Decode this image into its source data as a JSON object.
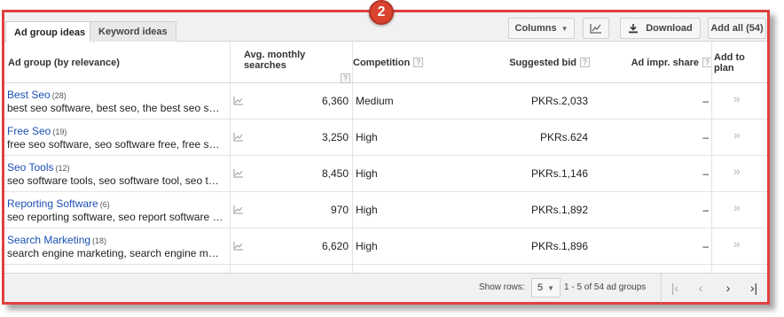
{
  "badge": "2",
  "tabs": [
    {
      "label": "Ad group ideas",
      "active": true
    },
    {
      "label": "Keyword ideas",
      "active": false
    }
  ],
  "toolbar": {
    "columns_label": "Columns",
    "chart_icon": "line-chart-icon",
    "download_label": "Download",
    "add_all_label": "Add all (54)"
  },
  "headers": {
    "ad_group": "Ad group (by relevance)",
    "avg_monthly": "Avg. monthly searches",
    "competition": "Competition",
    "suggested_bid": "Suggested bid",
    "ad_impr_share": "Ad impr. share",
    "add_to_plan": "Add to plan",
    "help_glyph": "?"
  },
  "rows": [
    {
      "name": "Best Seo",
      "count": "(28)",
      "keywords": "best seo software, best seo, the best seo software",
      "avg": "6,360",
      "competition": "Medium",
      "bid": "PKRs.2,033",
      "impr": "–",
      "add": "»"
    },
    {
      "name": "Free Seo",
      "count": "(19)",
      "keywords": "free seo software, seo software free, free seo tools",
      "avg": "3,250",
      "competition": "High",
      "bid": "PKRs.624",
      "impr": "–",
      "add": "»"
    },
    {
      "name": "Seo Tools",
      "count": "(12)",
      "keywords": "seo software tools, seo software tool, seo tools software",
      "avg": "8,450",
      "competition": "High",
      "bid": "PKRs.1,146",
      "impr": "–",
      "add": "»"
    },
    {
      "name": "Reporting Software",
      "count": "(6)",
      "keywords": "seo reporting software, seo report software tool",
      "avg": "970",
      "competition": "High",
      "bid": "PKRs.1,892",
      "impr": "–",
      "add": "»"
    },
    {
      "name": "Search Marketing",
      "count": "(18)",
      "keywords": "search engine marketing, search engine marketing software",
      "avg": "6,620",
      "competition": "High",
      "bid": "PKRs.1,896",
      "impr": "–",
      "add": "»"
    }
  ],
  "footer": {
    "show_rows_label": "Show rows:",
    "rows_value": "5",
    "range_text": "1 - 5 of 54 ad groups"
  },
  "colors": {
    "frame": "#e04040",
    "badge": "#d9432f",
    "link": "#1a4fb4"
  }
}
